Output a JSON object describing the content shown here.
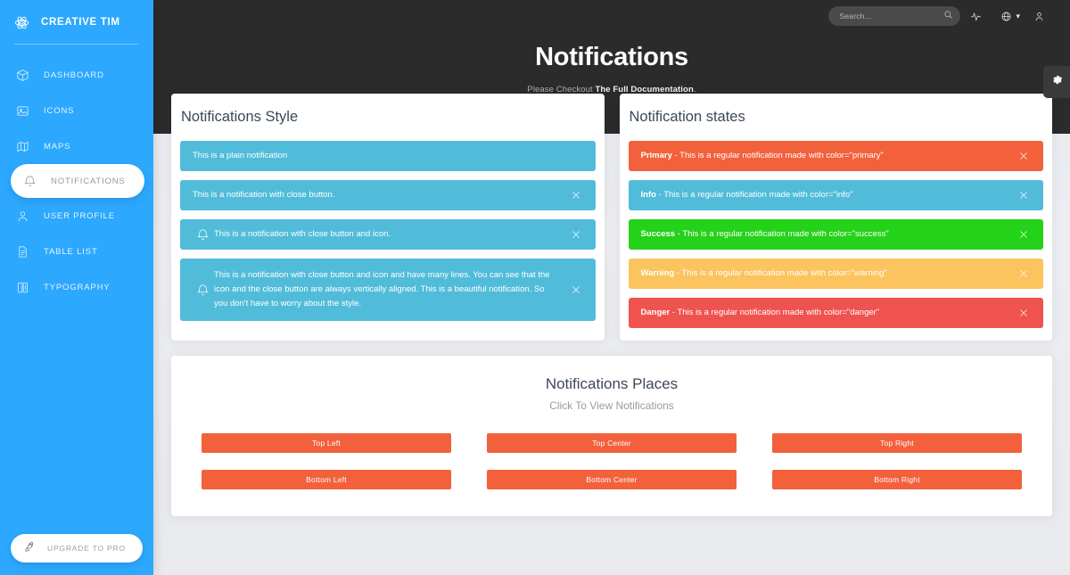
{
  "brand": {
    "name": "CREATIVE TIM",
    "logo_icon": "atom-icon"
  },
  "sidebar": {
    "items": [
      {
        "label": "DASHBOARD",
        "icon": "cube-icon",
        "active": false
      },
      {
        "label": "ICONS",
        "icon": "image-icon",
        "active": false
      },
      {
        "label": "MAPS",
        "icon": "map-icon",
        "active": false
      },
      {
        "label": "NOTIFICATIONS",
        "icon": "bell-icon",
        "active": true
      },
      {
        "label": "USER PROFILE",
        "icon": "person-icon",
        "active": false
      },
      {
        "label": "TABLE LIST",
        "icon": "document-icon",
        "active": false
      },
      {
        "label": "TYPOGRAPHY",
        "icon": "book-icon",
        "active": false
      }
    ],
    "upgrade": {
      "label": "UPGRADE TO PRO",
      "icon": "rocket-icon"
    }
  },
  "topbar": {
    "search": {
      "placeholder": "Search...",
      "value": "",
      "icon": "search-icon"
    },
    "icons": [
      {
        "name": "pulse-icon",
        "caret": false
      },
      {
        "name": "globe-icon",
        "caret": true
      },
      {
        "name": "user-icon",
        "caret": false
      }
    ],
    "caret_glyph": "▾",
    "settings": {
      "icon": "gear-icon"
    }
  },
  "header": {
    "title": "Notifications",
    "subtitle_prefix": "Please Checkout ",
    "subtitle_link": "The Full Documentation",
    "subtitle_suffix": "."
  },
  "colors": {
    "sidebar": "#2ca8ff",
    "dark": "#2b2b2b",
    "page_bg": "#e8eaee",
    "primary": "#f2613c",
    "info": "#51bcda",
    "success": "#24d219",
    "warning": "#fbc45e",
    "danger": "#ef5350",
    "text": "#3c4858"
  },
  "styles_card": {
    "title": "Notifications Style",
    "alerts": [
      {
        "text": "This is a plain notification",
        "color": "#51bcda",
        "icon": null,
        "close": false,
        "multiline": false
      },
      {
        "text": "This is a notification with close button.",
        "color": "#51bcda",
        "icon": null,
        "close": true,
        "multiline": false
      },
      {
        "text": "This is a notification with close button and icon.",
        "color": "#51bcda",
        "icon": "bell-icon",
        "close": true,
        "multiline": false
      },
      {
        "text": "This is a notification with close button and icon and have many lines. You can see that the icon and the close button are always vertically aligned. This is a beautiful notification. So you don't have to worry about the style.",
        "color": "#51bcda",
        "icon": "bell-icon",
        "close": true,
        "multiline": true
      }
    ]
  },
  "states_card": {
    "title": "Notification states",
    "alerts": [
      {
        "label": "Primary",
        "text": " - This is a regular notification made with color=\"primary\"",
        "color": "#f2613c",
        "close": true
      },
      {
        "label": "Info",
        "text": " - This is a regular notification made with color=\"info\"",
        "color": "#51bcda",
        "close": true
      },
      {
        "label": "Success",
        "text": " - This is a regular notification made with color=\"success\"",
        "color": "#24d219",
        "close": true
      },
      {
        "label": "Warning",
        "text": " - This is a regular notification made with color=\"warning\"",
        "color": "#fbc45e",
        "close": true
      },
      {
        "label": "Danger",
        "text": " - This is a regular notification made with color=\"danger\"",
        "color": "#ef5350",
        "close": true
      }
    ]
  },
  "places_card": {
    "title": "Notifications Places",
    "subtitle": "Click To View Notifications",
    "buttons": [
      {
        "label": "Top Left",
        "color": "#f2613c"
      },
      {
        "label": "Top Center",
        "color": "#f2613c"
      },
      {
        "label": "Top Right",
        "color": "#f2613c"
      },
      {
        "label": "Bottom Left",
        "color": "#f2613c"
      },
      {
        "label": "Bottom Center",
        "color": "#f2613c"
      },
      {
        "label": "Bottom Right",
        "color": "#f2613c"
      }
    ]
  }
}
